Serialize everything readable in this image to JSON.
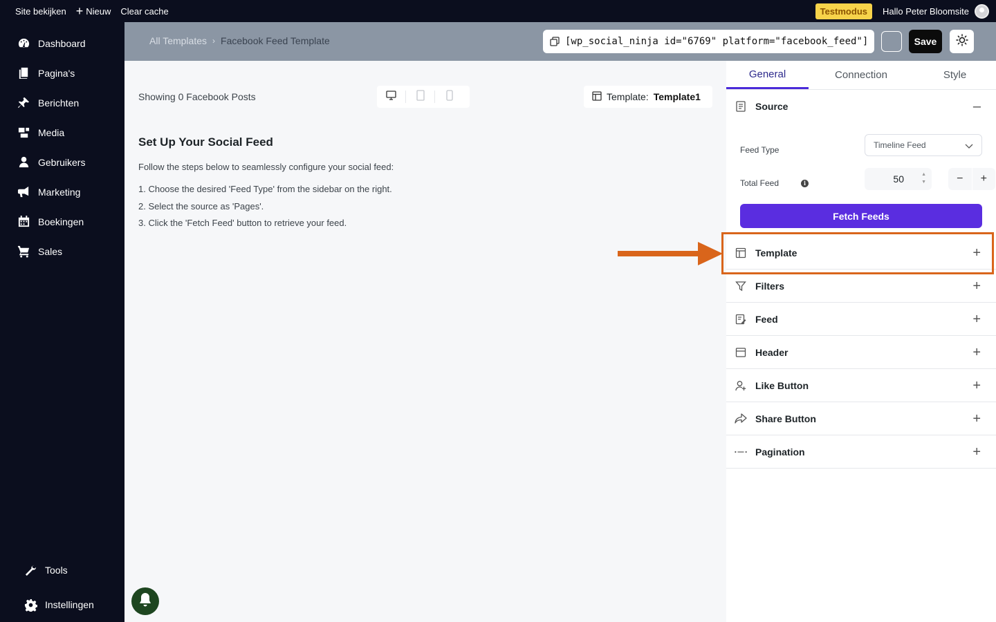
{
  "adminbar": {
    "view_site": "Site bekijken",
    "new": "Nieuw",
    "clear_cache": "Clear cache",
    "test_mode": "Testmodus",
    "howdy": "Hallo Peter Bloomsite"
  },
  "sidebar": {
    "items": [
      {
        "label": "Dashboard",
        "icon": "dashboard-icon"
      },
      {
        "label": "Pagina's",
        "icon": "pages-icon"
      },
      {
        "label": "Berichten",
        "icon": "pin-icon"
      },
      {
        "label": "Media",
        "icon": "media-icon"
      },
      {
        "label": "Gebruikers",
        "icon": "user-icon"
      },
      {
        "label": "Marketing",
        "icon": "megaphone-icon"
      },
      {
        "label": "Boekingen",
        "icon": "calendar-icon"
      },
      {
        "label": "Sales",
        "icon": "cart-icon"
      }
    ],
    "bottom": [
      {
        "label": "Tools",
        "icon": "wrench-icon"
      },
      {
        "label": "Instellingen",
        "icon": "gear-icon"
      }
    ]
  },
  "header": {
    "breadcrumb_root": "All Templates",
    "breadcrumb_current": "Facebook Feed Template",
    "shortcode": "[wp_social_ninja id=\"6769\" platform=\"facebook_feed\"]",
    "save_label": "Save"
  },
  "main": {
    "showing": "Showing 0 Facebook Posts",
    "template_label": "Template:",
    "template_value": "Template1",
    "setup_title": "Set Up Your Social Feed",
    "setup_intro": "Follow the steps below to seamlessly configure your social feed:",
    "steps": [
      "1. Choose the desired 'Feed Type' from the sidebar on the right.",
      "2. Select the source as 'Pages'.",
      "3. Click the 'Fetch Feed' button to retrieve your feed."
    ]
  },
  "panel": {
    "tabs": [
      "General",
      "Connection",
      "Style"
    ],
    "active_tab": "General",
    "source": {
      "title": "Source",
      "feed_type_label": "Feed Type",
      "feed_type_value": "Timeline Feed",
      "total_feed_label": "Total Feed",
      "total_feed_value": "50",
      "fetch_label": "Fetch Feeds"
    },
    "sections": [
      {
        "label": "Template",
        "icon": "template-icon"
      },
      {
        "label": "Filters",
        "icon": "filter-icon"
      },
      {
        "label": "Feed",
        "icon": "edit-icon"
      },
      {
        "label": "Header",
        "icon": "header-icon"
      },
      {
        "label": "Like Button",
        "icon": "user-add-icon"
      },
      {
        "label": "Share Button",
        "icon": "share-icon"
      },
      {
        "label": "Pagination",
        "icon": "dots-icon"
      }
    ]
  },
  "colors": {
    "accent": "#5a2de0",
    "highlight": "#d9651b",
    "sidebar": "#0b0e1e",
    "test_mode": "#f7d34a"
  }
}
